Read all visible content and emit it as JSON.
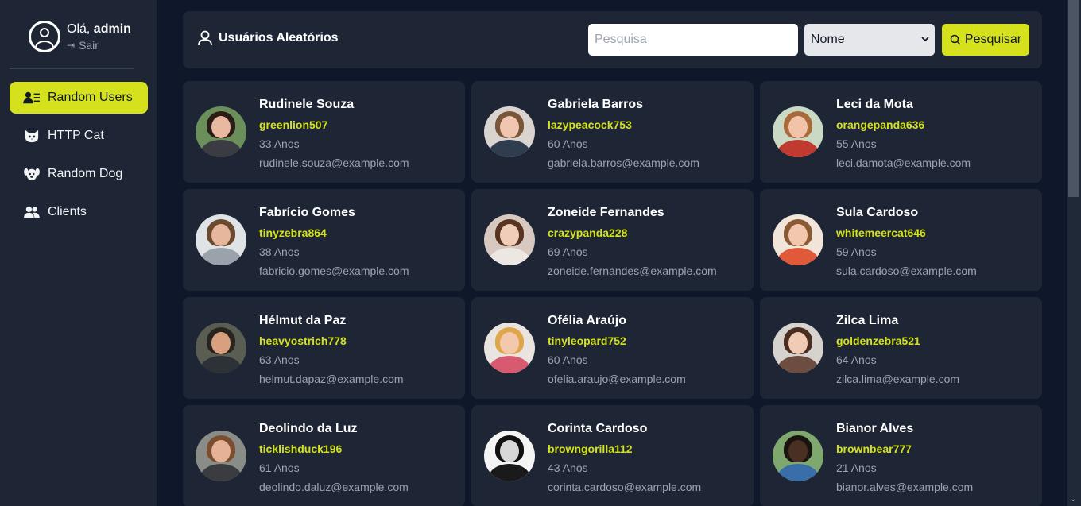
{
  "sidebar": {
    "greeting": "Olá,",
    "username": "admin",
    "logout_label": "Sair",
    "items": [
      {
        "label": "Random Users",
        "icon": "users-list-icon",
        "active": true
      },
      {
        "label": "HTTP Cat",
        "icon": "cat-icon",
        "active": false
      },
      {
        "label": "Random Dog",
        "icon": "dog-icon",
        "active": false
      },
      {
        "label": "Clients",
        "icon": "clients-icon",
        "active": false
      }
    ]
  },
  "header": {
    "title": "Usuários Aleatórios",
    "search_placeholder": "Pesquisa",
    "search_value": "",
    "select_value": "Nome",
    "search_button": "Pesquisar"
  },
  "users": [
    {
      "name": "Rudinele Souza",
      "username": "greenlion507",
      "age": "33 Anos",
      "email": "rudinele.souza@example.com"
    },
    {
      "name": "Gabriela Barros",
      "username": "lazypeacock753",
      "age": "60 Anos",
      "email": "gabriela.barros@example.com"
    },
    {
      "name": "Leci da Mota",
      "username": "orangepanda636",
      "age": "55 Anos",
      "email": "leci.damota@example.com"
    },
    {
      "name": "Fabrício Gomes",
      "username": "tinyzebra864",
      "age": "38 Anos",
      "email": "fabricio.gomes@example.com"
    },
    {
      "name": "Zoneide Fernandes",
      "username": "crazypanda228",
      "age": "69 Anos",
      "email": "zoneide.fernandes@example.com"
    },
    {
      "name": "Sula Cardoso",
      "username": "whitemeercat646",
      "age": "59 Anos",
      "email": "sula.cardoso@example.com"
    },
    {
      "name": "Hélmut da Paz",
      "username": "heavyostrich778",
      "age": "63 Anos",
      "email": "helmut.dapaz@example.com"
    },
    {
      "name": "Ofélia Araújo",
      "username": "tinyleopard752",
      "age": "60 Anos",
      "email": "ofelia.araujo@example.com"
    },
    {
      "name": "Zilca Lima",
      "username": "goldenzebra521",
      "age": "64 Anos",
      "email": "zilca.lima@example.com"
    },
    {
      "name": "Deolindo da Luz",
      "username": "ticklishduck196",
      "age": "61 Anos",
      "email": "deolindo.daluz@example.com"
    },
    {
      "name": "Corinta Cardoso",
      "username": "browngorilla112",
      "age": "43 Anos",
      "email": "corinta.cardoso@example.com"
    },
    {
      "name": "Bianor Alves",
      "username": "brownbear777",
      "age": "21 Anos",
      "email": "bianor.alves@example.com"
    }
  ],
  "colors": {
    "accent": "#d4e11c",
    "background": "#0f172a",
    "panel": "#1e2636"
  }
}
